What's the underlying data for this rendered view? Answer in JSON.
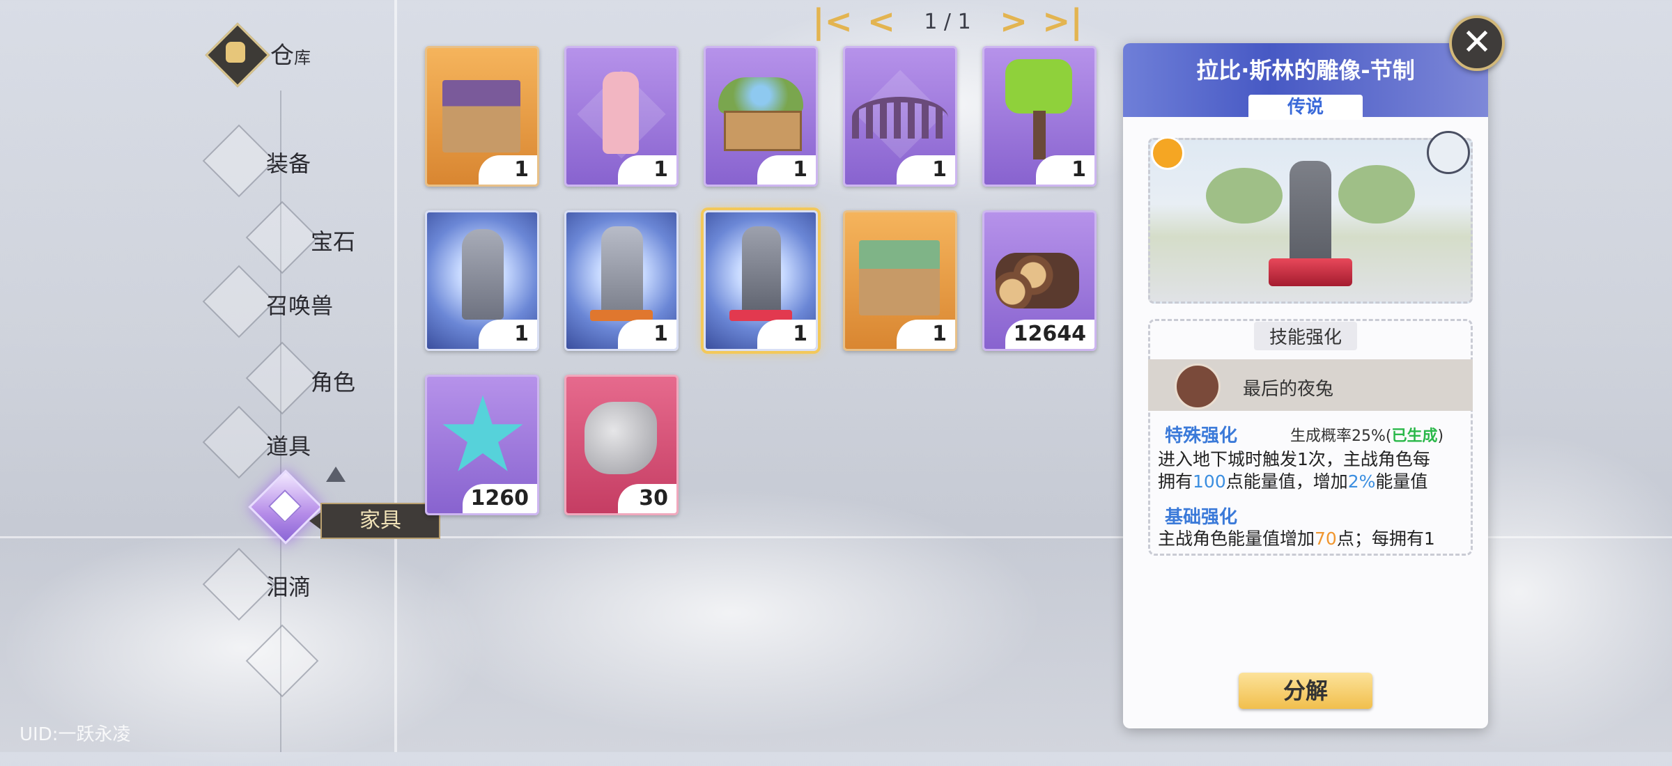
{
  "nav": {
    "warehouse_label": "仓",
    "warehouse_label_small": "库",
    "items": [
      {
        "label": "装备"
      },
      {
        "label": "宝石"
      },
      {
        "label": "召唤兽"
      },
      {
        "label": "角色"
      },
      {
        "label": "道具"
      },
      {
        "label": "家具"
      },
      {
        "label": "泪滴"
      }
    ],
    "uid": "UID:一跃永凌"
  },
  "pager": {
    "first": "|<",
    "prev": "<",
    "text": "1 / 1",
    "next": ">",
    "last": ">|"
  },
  "grid": {
    "slots": [
      {
        "count": "1",
        "rarity": "orange",
        "icon": "shop-building-icon"
      },
      {
        "count": "1",
        "rarity": "purple",
        "icon": "pink-statue-icon"
      },
      {
        "count": "1",
        "rarity": "purple",
        "icon": "flower-planter-icon"
      },
      {
        "count": "1",
        "rarity": "purple",
        "icon": "wooden-fence-icon"
      },
      {
        "count": "1",
        "rarity": "purple",
        "icon": "tree-icon"
      },
      {
        "count": "1",
        "rarity": "legend",
        "icon": "statue-hat-icon"
      },
      {
        "count": "1",
        "rarity": "legend",
        "icon": "statue-sword-icon"
      },
      {
        "count": "1",
        "rarity": "legend",
        "icon": "statue-rabbit-icon"
      },
      {
        "count": "1",
        "rarity": "orange",
        "icon": "green-roof-shop-icon"
      },
      {
        "count": "12644",
        "rarity": "purple",
        "icon": "wood-logs-icon"
      },
      {
        "count": "1260",
        "rarity": "purple",
        "icon": "crystal-star-icon"
      },
      {
        "count": "30",
        "rarity": "red",
        "icon": "stone-ore-icon"
      }
    ]
  },
  "detail": {
    "title": "拉比·斯林的雕像-节制",
    "rarity": "传说",
    "skill_section": "技能强化",
    "skill_name": "最后的夜兔",
    "special_label": "特殊强化",
    "special_rate_prefix": "生成概率25%(",
    "special_rate_status": "已生成",
    "special_rate_suffix": ")",
    "desc1": "进入地下城时触发1次，主战角色每",
    "desc2_a": "拥有",
    "desc2_b": "100",
    "desc2_c": "点能量值，增加",
    "desc2_d": "2%",
    "desc2_e": "能量值",
    "base_label": "基础强化",
    "desc3_a": "主战角色能量值增加",
    "desc3_b": "70",
    "desc3_c": "点；每拥有1",
    "decompose": "分解"
  },
  "close_icon": "close-icon",
  "colors": {
    "accent_gold": "#e3b450",
    "legend_blue": "#4759c4",
    "highlight_blue": "#3b8ee0",
    "green": "#2bb84a"
  }
}
